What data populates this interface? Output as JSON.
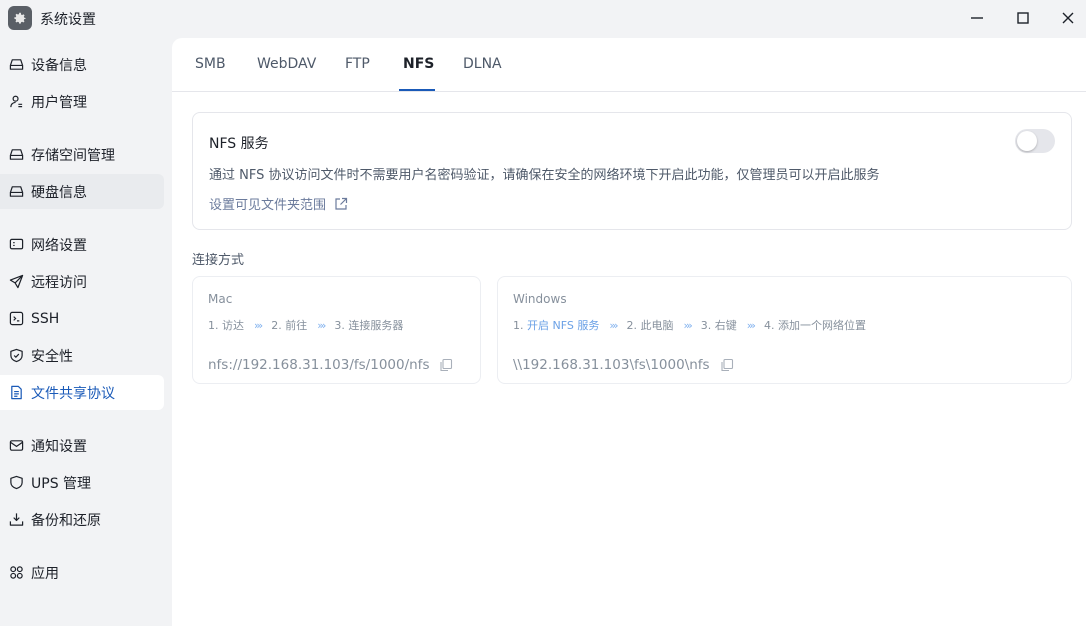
{
  "window": {
    "title": "系统设置"
  },
  "sidebar": {
    "items": [
      {
        "label": "设备信息",
        "icon": "drive-icon"
      },
      {
        "label": "用户管理",
        "icon": "user-icon"
      },
      {
        "label": "存储空间管理",
        "icon": "drive-icon"
      },
      {
        "label": "硬盘信息",
        "icon": "drive-icon"
      },
      {
        "label": "网络设置",
        "icon": "network-icon"
      },
      {
        "label": "远程访问",
        "icon": "send-icon"
      },
      {
        "label": "SSH",
        "icon": "terminal-icon"
      },
      {
        "label": "安全性",
        "icon": "shield-check-icon"
      },
      {
        "label": "文件共享协议",
        "icon": "document-icon"
      },
      {
        "label": "通知设置",
        "icon": "mail-icon"
      },
      {
        "label": "UPS 管理",
        "icon": "shield-icon"
      },
      {
        "label": "备份和还原",
        "icon": "backup-icon"
      },
      {
        "label": "应用",
        "icon": "apps-icon"
      }
    ],
    "active_item": "文件共享协议",
    "hover_item": "硬盘信息"
  },
  "tabs": [
    {
      "label": "SMB"
    },
    {
      "label": "WebDAV"
    },
    {
      "label": "FTP"
    },
    {
      "label": "NFS"
    },
    {
      "label": "DLNA"
    }
  ],
  "active_tab": "NFS",
  "nfs_card": {
    "title": "NFS 服务",
    "toggle_on": false,
    "description": "通过 NFS 协议访问文件时不需要用户名密码验证，请确保在安全的网络环境下开启此功能，仅管理员可以开启此服务",
    "link_label": "设置可见文件夹范围"
  },
  "connection": {
    "title": "连接方式",
    "mac": {
      "os": "Mac",
      "steps": [
        "1. 访达",
        "2. 前往",
        "3. 连接服务器"
      ],
      "path": "nfs://192.168.31.103/fs/1000/nfs"
    },
    "windows": {
      "os": "Windows",
      "step1_prefix": "1. ",
      "step1_link": "开启 NFS 服务",
      "steps": [
        "2. 此电脑",
        "3. 右键",
        "4. 添加一个网络位置"
      ],
      "path": "\\\\192.168.31.103\\fs\\1000\\nfs"
    },
    "arrow": "›››"
  },
  "colors": {
    "accent": "#1a5ab8",
    "link": "#6aa0e6",
    "sidebar_bg": "#f2f3f5"
  }
}
